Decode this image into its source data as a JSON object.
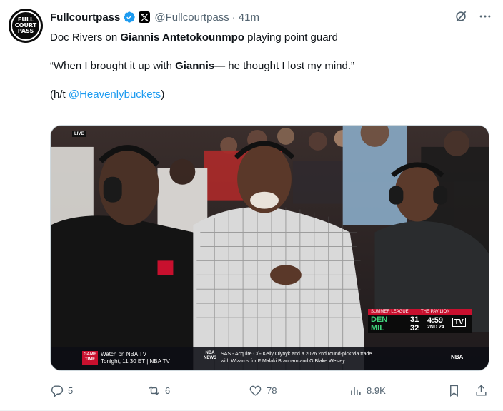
{
  "author": {
    "display_name": "Fullcourtpass",
    "handle": "@Fullcourtpass",
    "separator": "·",
    "time": "41m",
    "avatar_text": [
      "FULL",
      "COURT",
      "PASS"
    ]
  },
  "tweet": {
    "line1_pre": "Doc Rivers on ",
    "line1_bold": "Giannis Antetokounmpo",
    "line1_post": " playing point guard",
    "line2_pre": "“When I brought it up with ",
    "line2_bold": "Giannis",
    "line2_post": "— he thought I lost my mind.”",
    "line3_pre": "(h/t ",
    "line3_link": "@Heavenlybuckets",
    "line3_post": ")"
  },
  "media": {
    "live_label": "LIVE",
    "lower_third": {
      "game_time_badge": [
        "GAME",
        "TIME"
      ],
      "watch_line1": "Watch on NBA TV",
      "watch_line2": "Tonight, 11:30 ET | NBA TV",
      "news_badge": [
        "NBA",
        "NEWS"
      ],
      "news_line1": "SAS - Acquire C/F Kelly Olynyk and a 2026 2nd round-pick via trade",
      "news_line2": "with Wizards for F Malaki Branham and G Blake Wesley",
      "right_logo": "NBA"
    },
    "scoreboard": {
      "left_header": "SUMMER LEAGUE",
      "right_header": "THE PAVILION",
      "team1": "DEN",
      "score1": "31",
      "team2": "MIL",
      "score2": "32",
      "clock": "4:59",
      "period": "2ND 24",
      "network": "TV"
    }
  },
  "actions": {
    "replies": "5",
    "reposts": "6",
    "likes": "78",
    "views": "8.9K"
  },
  "colors": {
    "link": "#1d9bf0",
    "secondary_text": "#536471",
    "verified": "#1d9bf0",
    "scoreboard_red": "#c8102e"
  }
}
